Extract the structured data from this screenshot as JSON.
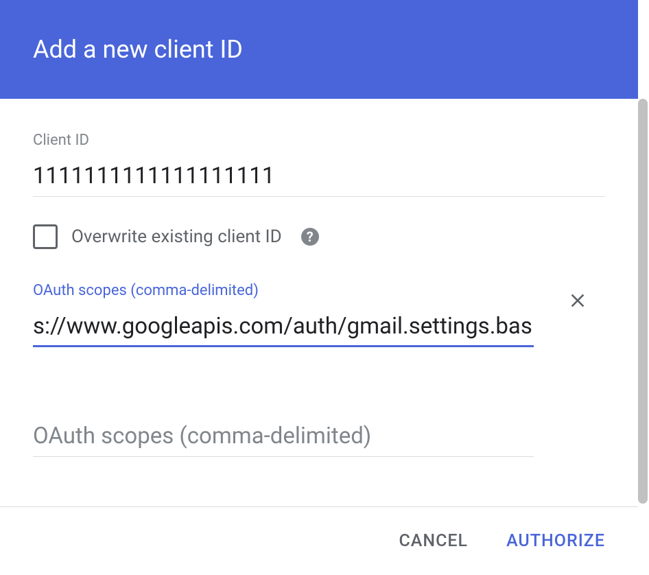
{
  "header": {
    "title": "Add a new client ID"
  },
  "client_id": {
    "label": "Client ID",
    "value": "1111111111111111111"
  },
  "overwrite": {
    "label": "Overwrite existing client ID",
    "checked": false
  },
  "scopes_field": {
    "label": "OAuth scopes (comma-delimited)",
    "value": "s://www.googleapis.com/auth/gmail.settings.basic"
  },
  "scopes_placeholder": {
    "placeholder": "OAuth scopes (comma-delimited)"
  },
  "footer": {
    "cancel_label": "CANCEL",
    "authorize_label": "AUTHORIZE"
  }
}
